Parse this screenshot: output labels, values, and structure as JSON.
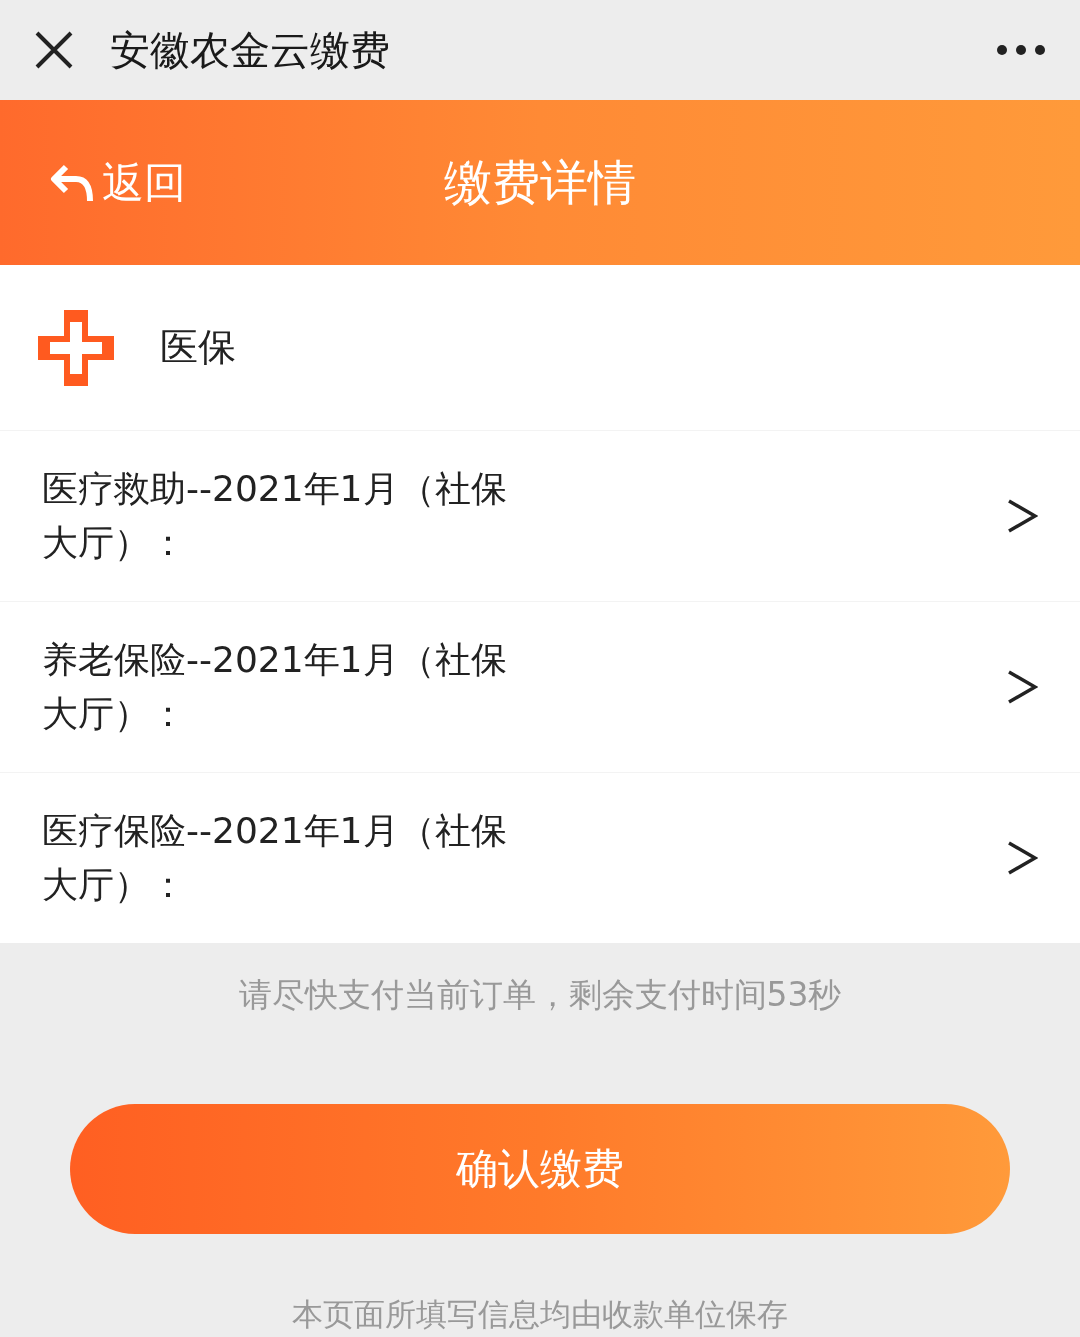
{
  "window": {
    "title": "安徽农金云缴费"
  },
  "header": {
    "back_label": "返回",
    "title": "缴费详情"
  },
  "category": {
    "label": "医保"
  },
  "items": [
    {
      "label": "医疗救助--2021年1月（社保大厅）："
    },
    {
      "label": "养老保险--2021年1月（社保大厅）："
    },
    {
      "label": "医疗保险--2021年1月（社保大厅）："
    }
  ],
  "notice": "请尽快支付当前订单，剩余支付时间53秒",
  "confirm_button": "确认缴费",
  "footer": "本页面所填写信息均由收款单位保存"
}
